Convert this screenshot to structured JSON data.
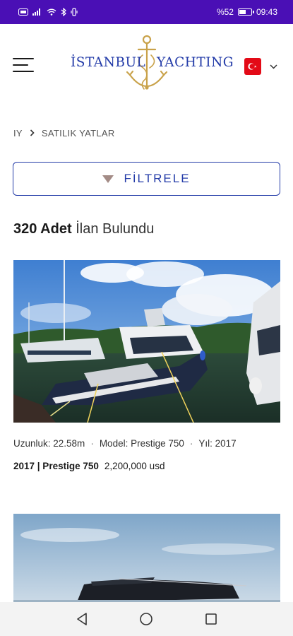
{
  "status_bar": {
    "battery_text": "%52",
    "battery_level": 0.52,
    "time": "09:43"
  },
  "header": {
    "logo_left": "İSTANBUL",
    "logo_right": "YACHTING",
    "language_flag": "turkey-flag"
  },
  "breadcrumb": {
    "home": "IY",
    "current": "SATILIK YATLAR"
  },
  "filter": {
    "label": "FİLTRELE"
  },
  "results": {
    "count": "320 Adet",
    "suffix": "İlan Bulundu"
  },
  "listings": [
    {
      "length": "Uzunluk: 22.58m",
      "model": "Model: Prestige 750",
      "year": "Yıl: 2017",
      "title": "2017 | Prestige 750",
      "price": "2,200,000 usd"
    }
  ],
  "colors": {
    "status_bar": "#4a0fb5",
    "brand_blue": "#233ba8",
    "brand_gold": "#c9a24a",
    "filter_icon": "#a38b86"
  }
}
